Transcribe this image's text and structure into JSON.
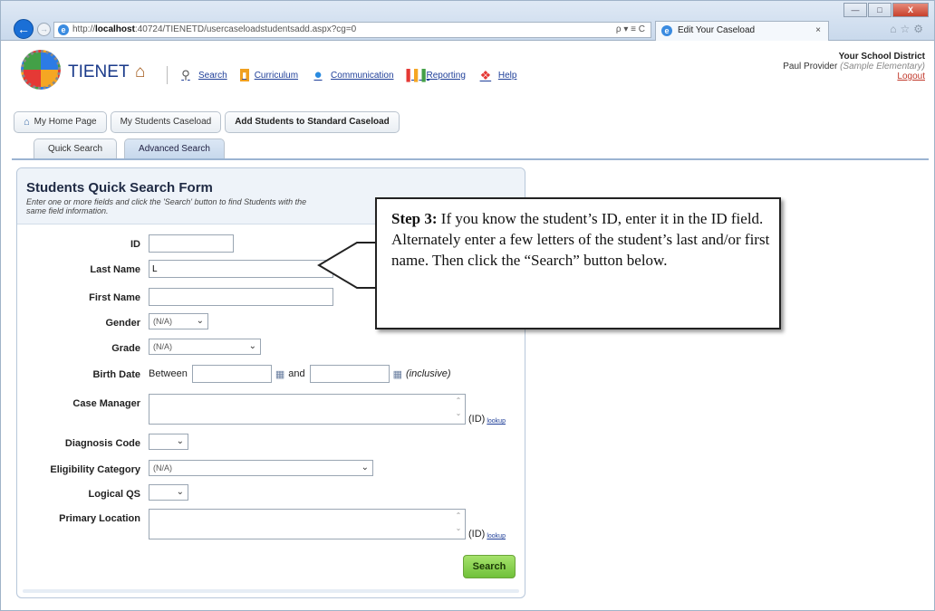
{
  "browser": {
    "url_prefix": "http://",
    "url_host": "localhost",
    "url_rest": ":40724/TIENETD/usercaseloadstudentsadd.aspx?cg=0",
    "addr_controls": "ρ ▾ ≡ C",
    "tab_title": "Edit Your Caseload",
    "tab_close": "×",
    "win_min": "—",
    "win_max": "□",
    "win_close": "X"
  },
  "app": {
    "logo_text": "TIENET",
    "nav": [
      {
        "label": "Search",
        "icon": "search-icon"
      },
      {
        "label": "Curriculum",
        "icon": "book-icon"
      },
      {
        "label": "Communication",
        "icon": "chat-bubble-icon"
      },
      {
        "label": "Reporting",
        "icon": "bar-chart-icon"
      },
      {
        "label": "Help",
        "icon": "help-icon"
      }
    ],
    "district": "Your School District",
    "provider": "Paul Provider",
    "provider_school": "(Sample Elementary)",
    "logout": "Logout"
  },
  "breadcrumbs": [
    "My Home Page",
    "My Students Caseload",
    "Add Students to Standard Caseload"
  ],
  "tabs": [
    "Quick Search",
    "Advanced Search"
  ],
  "form": {
    "title": "Students Quick Search Form",
    "subtitle": "Enter one or more fields and click the 'Search' button to find Students with the same field information.",
    "fields": {
      "id": "ID",
      "last_name": "Last Name",
      "last_name_value": "L",
      "first_name": "First Name",
      "gender": "Gender",
      "gender_value": "(N/A)",
      "grade": "Grade",
      "grade_value": "(N/A)",
      "birth_date": "Birth Date",
      "between": "Between",
      "and": "and",
      "inclusive": "(inclusive)",
      "case_manager": "Case Manager",
      "diagnosis_code": "Diagnosis Code",
      "eligibility": "Eligibility Category",
      "eligibility_value": "(N/A)",
      "logical_qs": "Logical QS",
      "primary_location": "Primary Location",
      "id_suffix": "(ID)",
      "lookup": "lookup"
    },
    "search_button": "Search"
  },
  "callout": {
    "step": "Step 3:",
    "text": " If you know the student’s ID, enter it in the ID field.  Alternately enter a few letters of the student’s last and/or first name.  Then click the “Search” button below."
  }
}
